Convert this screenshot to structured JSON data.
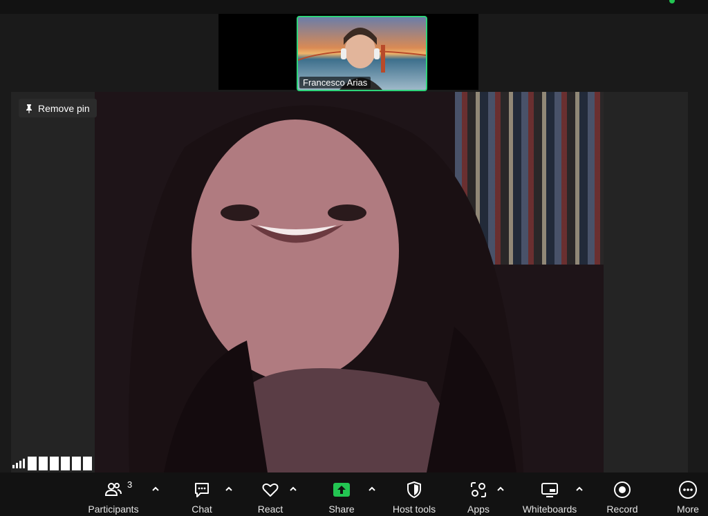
{
  "meeting": {
    "thumbnail_participant_name": "Francesco Arias",
    "pin_button_label": "Remove pin"
  },
  "toolbar": {
    "participants_label": "Participants",
    "participants_count": "3",
    "chat_label": "Chat",
    "react_label": "React",
    "share_label": "Share",
    "host_tools_label": "Host tools",
    "apps_label": "Apps",
    "whiteboards_label": "Whiteboards",
    "record_label": "Record",
    "more_label": "More"
  },
  "colors": {
    "accent_green": "#2ed47a",
    "share_green": "#23c552",
    "toolbar_bg": "#121212"
  },
  "icons": [
    "pin-icon",
    "participants-icon",
    "chat-icon",
    "react-icon",
    "share-icon",
    "shield-icon",
    "apps-icon",
    "whiteboard-icon",
    "record-icon",
    "more-icon",
    "caret-up-icon",
    "signal-icon"
  ]
}
